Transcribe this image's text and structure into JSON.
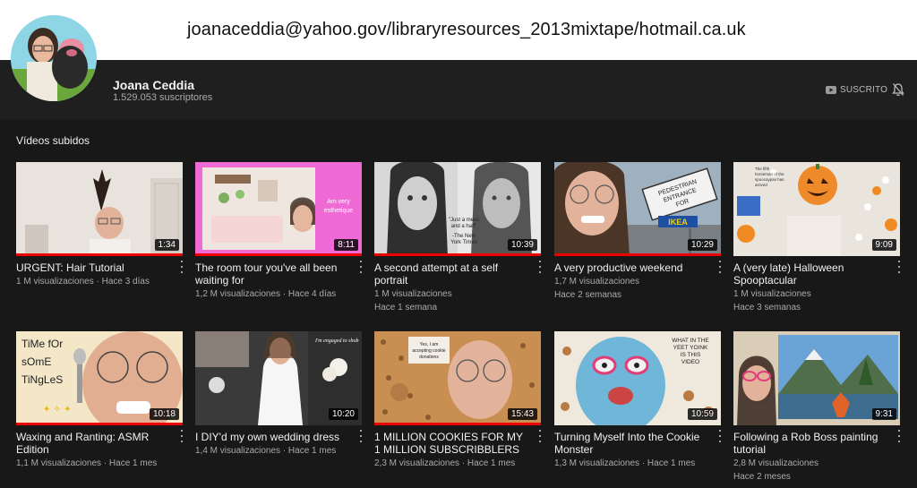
{
  "header": {
    "title": "joanaceddia@yahoo.gov/libraryresources_2013mixtape/hotmail.ca.uk"
  },
  "channel": {
    "name": "Joana Ceddia",
    "subscribers": "1.529.053 suscriptores",
    "subscribe_label": "SUSCRITO",
    "icons": {
      "subscribe": "youtube-icon",
      "bell": "bell-off-icon"
    }
  },
  "section": {
    "title": "Vídeos subidos"
  },
  "videos": [
    {
      "title": "URGENT: Hair Tutorial",
      "duration": "1:34",
      "meta1": "1 M visualizaciones · Hace 3 días",
      "meta2": ""
    },
    {
      "title": "The room tour you've all been waiting for",
      "duration": "8:11",
      "meta1": "1,2 M visualizaciones · Hace 4 días",
      "meta2": "",
      "thumb_text": "Am very esthetique"
    },
    {
      "title": "A second attempt at a self portrait",
      "duration": "10:39",
      "meta1": "1 M visualizaciones",
      "meta2": "Hace 1 semana",
      "thumb_text": "\"Just a mess and a half\" -The New York Times"
    },
    {
      "title": "A very productive weekend",
      "duration": "10:29",
      "meta1": "1,7 M visualizaciones",
      "meta2": "Hace 2 semanas",
      "thumb_text": "PEDESTRIAN ENTRANCE FOR IKEA"
    },
    {
      "title": "A (very late) Halloween Spooptacular",
      "duration": "9:09",
      "meta1": "1 M visualizaciones",
      "meta2": "Hace 3 semanas",
      "thumb_text": "The fifth horseman of the spoocaypse has arrived"
    },
    {
      "title": "Waxing and Ranting: ASMR Edition",
      "duration": "10:18",
      "meta1": "1,1 M visualizaciones · Hace 1 mes",
      "meta2": "",
      "thumb_text": "TiMe fOr sOmE TiNgLeS"
    },
    {
      "title": "I DIY'd my own wedding dress",
      "duration": "10:20",
      "meta1": "1,4 M visualizaciones · Hace 1 mes",
      "meta2": "",
      "thumb_text": "I'm engaged to shob"
    },
    {
      "title": "1 MILLION COOKIES FOR MY 1 MILLION SUBSCRIBBLERS",
      "duration": "15:43",
      "meta1": "2,3 M visualizaciones · Hace 1 mes",
      "meta2": "",
      "thumb_text": "Yes, I am accepting cookie donations"
    },
    {
      "title": "Turning Myself Into the Cookie Monster",
      "duration": "10:59",
      "meta1": "1,3 M visualizaciones · Hace 1 mes",
      "meta2": "",
      "thumb_text": "WHAT IN THE YEET YOINK IS THIS VIDEO"
    },
    {
      "title": "Following a Rob Boss painting tutorial",
      "duration": "9:31",
      "meta1": "2,8 M visualizaciones",
      "meta2": "Hace 2 meses"
    }
  ],
  "colors": {
    "page_bg": "#181818",
    "header_bg": "#ffffff",
    "channel_bg": "#1f1f1f",
    "progress": "#e00000",
    "text_primary": "#f1f1f1",
    "text_secondary": "#aaaaaa"
  }
}
